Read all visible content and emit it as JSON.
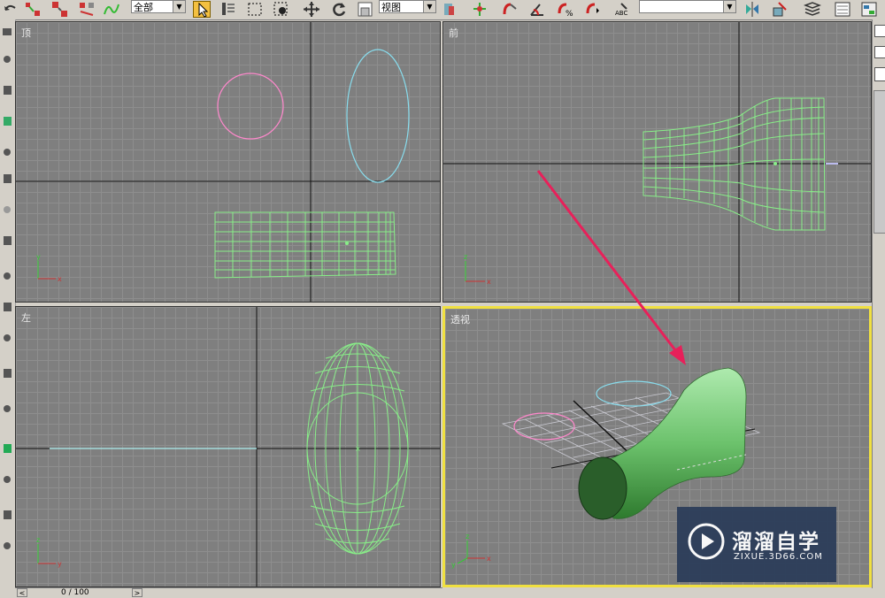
{
  "toolbar": {
    "selection_filter": "全部",
    "reference_coord": "视图",
    "named_selection": "",
    "icons": [
      "undo-icon",
      "select-link-icon",
      "unlink-icon",
      "bind-spacewarp-icon",
      "select-object-icon",
      "select-by-name-icon",
      "rect-region-icon",
      "window-crossing-icon",
      "move-icon",
      "rotate-icon",
      "scale-icon",
      "pivot-icon",
      "manipulate-icon",
      "snap-icon",
      "angle-snap-icon",
      "percent-snap-icon",
      "spinner-snap-icon",
      "edit-named-sel-icon",
      "mirror-icon",
      "align-icon",
      "layer-icon",
      "curve-editor-icon"
    ]
  },
  "viewports": {
    "top": {
      "label": "顶"
    },
    "front": {
      "label": "前"
    },
    "left": {
      "label": "左"
    },
    "perspective": {
      "label": "透视"
    }
  },
  "axis": {
    "x": "x",
    "y": "y",
    "z": "z"
  },
  "timeline": {
    "frame": "0 / 100"
  },
  "watermark": {
    "title": "溜溜自学",
    "subtitle": "ZIXUE.3D66.COM"
  },
  "colors": {
    "viewport_bg": "#7f7f7f",
    "grid": "#8e8e8e",
    "active_border": "#f0e040",
    "wire": "#88ee88",
    "circle": "#ff88cc",
    "ellipse": "#88ddee",
    "arrow": "#e8205a"
  }
}
